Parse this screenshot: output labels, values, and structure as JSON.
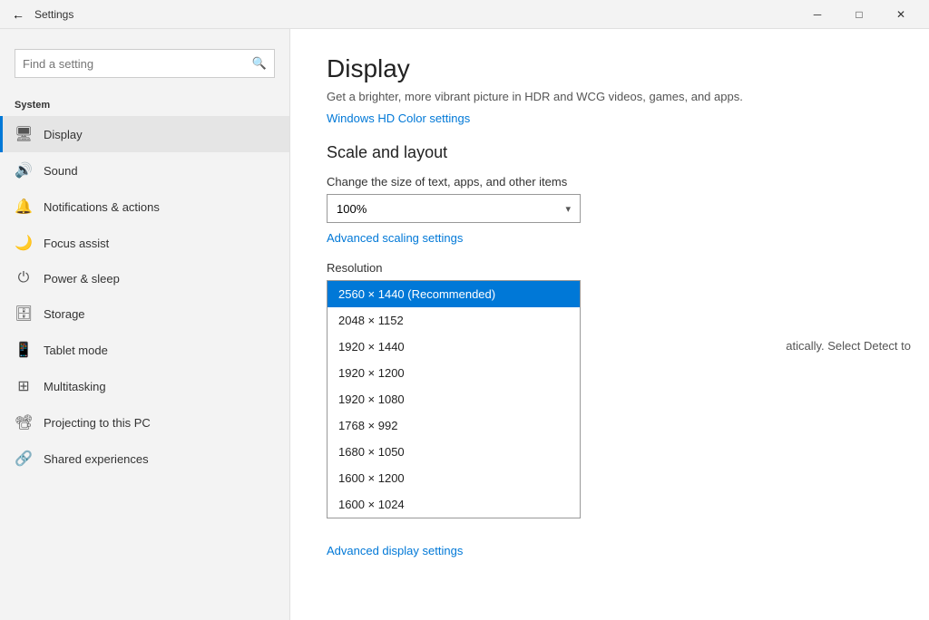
{
  "titleBar": {
    "backIcon": "←",
    "title": "Settings",
    "minimizeIcon": "─",
    "maximizeIcon": "□",
    "closeIcon": "✕"
  },
  "sidebar": {
    "searchPlaceholder": "Find a setting",
    "searchIcon": "🔍",
    "sectionLabel": "System",
    "navItems": [
      {
        "id": "display",
        "label": "Display",
        "icon": "🖥",
        "active": true
      },
      {
        "id": "sound",
        "label": "Sound",
        "icon": "🔊",
        "active": false
      },
      {
        "id": "notifications",
        "label": "Notifications & actions",
        "icon": "🔔",
        "active": false
      },
      {
        "id": "focus",
        "label": "Focus assist",
        "icon": "🌙",
        "active": false
      },
      {
        "id": "power",
        "label": "Power & sleep",
        "icon": "⏻",
        "active": false
      },
      {
        "id": "storage",
        "label": "Storage",
        "icon": "🗄",
        "active": false
      },
      {
        "id": "tablet",
        "label": "Tablet mode",
        "icon": "📱",
        "active": false
      },
      {
        "id": "multitasking",
        "label": "Multitasking",
        "icon": "⊞",
        "active": false
      },
      {
        "id": "projecting",
        "label": "Projecting to this PC",
        "icon": "📽",
        "active": false
      },
      {
        "id": "shared",
        "label": "Shared experiences",
        "icon": "🔗",
        "active": false
      }
    ]
  },
  "content": {
    "pageTitle": "Display",
    "pageDesc": "Get a brighter, more vibrant picture in HDR and WCG videos, games, and apps.",
    "hdrLink": "Windows HD Color settings",
    "scaleSection": "Scale and layout",
    "scaleLabel": "Change the size of text, apps, and other items",
    "scaleValue": "100%",
    "advancedScalingLink": "Advanced scaling settings",
    "resolutionLabel": "Resolution",
    "resolutionOptions": [
      {
        "label": "2560 × 1440 (Recommended)",
        "selected": true
      },
      {
        "label": "2048 × 1152",
        "selected": false
      },
      {
        "label": "1920 × 1440",
        "selected": false
      },
      {
        "label": "1920 × 1200",
        "selected": false
      },
      {
        "label": "1920 × 1080",
        "selected": false
      },
      {
        "label": "1768 × 992",
        "selected": false
      },
      {
        "label": "1680 × 1050",
        "selected": false
      },
      {
        "label": "1600 × 1200",
        "selected": false
      },
      {
        "label": "1600 × 1024",
        "selected": false
      }
    ],
    "partialText": "atically. Select Detect to",
    "advancedDisplayLink": "Advanced display settings"
  }
}
